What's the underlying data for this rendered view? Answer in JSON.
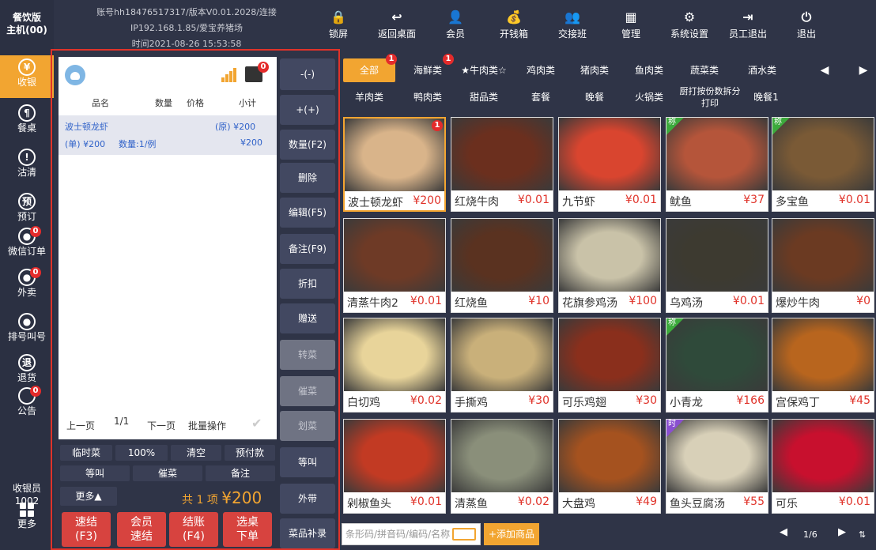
{
  "rail": {
    "brand_line1": "餐饮版",
    "brand_line2": "主机(00)",
    "items": [
      {
        "label": "收银",
        "icon": "¥",
        "badge": ""
      },
      {
        "label": "餐桌",
        "icon": "¶",
        "badge": ""
      },
      {
        "label": "沽清",
        "icon": "!",
        "badge": ""
      },
      {
        "label": "预订",
        "icon": "预",
        "badge": ""
      },
      {
        "label": "微信订单",
        "icon": "●",
        "badge": "0"
      },
      {
        "label": "外卖",
        "icon": "●",
        "badge": "0"
      },
      {
        "label": "排号叫号",
        "icon": "●",
        "badge": ""
      },
      {
        "label": "退货",
        "icon": "退",
        "badge": ""
      },
      {
        "label": "公告",
        "icon": "",
        "badge": "0"
      }
    ],
    "cashier_label": "收银员",
    "cashier_id": "1002",
    "more_label": "更多"
  },
  "info": {
    "account": "账号hh18476517317/版本V0.01.2028/连接",
    "ip": "IP192.168.1.85/爱宝养猪场",
    "time": "时间2021-08-26 15:53:58"
  },
  "toolbar": [
    {
      "label": "锁屏",
      "icon": "lock-icon",
      "glyph": "🔒"
    },
    {
      "label": "返回桌面",
      "icon": "back-icon",
      "glyph": "↩"
    },
    {
      "label": "会员",
      "icon": "member-icon",
      "glyph": "👤"
    },
    {
      "label": "开钱箱",
      "icon": "cash-box-icon",
      "glyph": "💰"
    },
    {
      "label": "交接班",
      "icon": "shift-icon",
      "glyph": "👥"
    },
    {
      "label": "管理",
      "icon": "grid-icon",
      "glyph": "▦"
    },
    {
      "label": "系统设置",
      "icon": "gear-icon",
      "glyph": "⚙"
    },
    {
      "label": "员工退出",
      "icon": "exit-door-icon",
      "glyph": "⇥"
    },
    {
      "label": "退出",
      "icon": "power-icon",
      "glyph": "⏻"
    }
  ],
  "order": {
    "printer_badge": "0",
    "columns": {
      "name": "品名",
      "qty": "数量",
      "price": "价格",
      "subtotal": "小计"
    },
    "line": {
      "name": "波士顿龙虾",
      "orig_price": "(原) ¥200",
      "unit_price": "(单) ¥200",
      "qty": "数量:1/例",
      "subtotal": "¥200"
    },
    "pager": {
      "prev": "上一页",
      "page": "1/1",
      "next": "下一页",
      "batch": "批量操作"
    },
    "row1": [
      "临时菜",
      "100%",
      "清空",
      "预付款"
    ],
    "row2": [
      "等叫",
      "催菜",
      "备注"
    ],
    "more": "更多▲",
    "total_prefix": "共",
    "total_count": "1",
    "total_unit": "项",
    "total_amount": "¥200",
    "buttons": [
      {
        "line1": "速结",
        "line2": "(F3)"
      },
      {
        "line1": "会员",
        "line2": "速结"
      },
      {
        "line1": "结账",
        "line2": "(F4)"
      },
      {
        "line1": "选桌",
        "line2": "下单"
      }
    ]
  },
  "actions": [
    {
      "label": "-(-)",
      "disabled": false
    },
    {
      "label": "+(+)",
      "disabled": false
    },
    {
      "label": "数量(F2)",
      "disabled": false
    },
    {
      "label": "删除",
      "disabled": false
    },
    {
      "label": "编辑(F5)",
      "disabled": false
    },
    {
      "label": "备注(F9)",
      "disabled": false
    },
    {
      "label": "折扣",
      "disabled": false
    },
    {
      "label": "赠送",
      "disabled": false
    },
    {
      "label": "转菜",
      "disabled": true
    },
    {
      "label": "催菜",
      "disabled": true
    },
    {
      "label": "划菜",
      "disabled": true
    },
    {
      "label": "等叫",
      "disabled": false
    },
    {
      "label": "外带",
      "disabled": false
    },
    {
      "label": "菜品补录",
      "disabled": false
    }
  ],
  "categories_row1": [
    {
      "label": "全部",
      "badge": "1",
      "active": true
    },
    {
      "label": "海鲜类",
      "badge": "1",
      "active": false
    },
    {
      "label": "★牛肉类☆",
      "badge": "",
      "active": false
    },
    {
      "label": "鸡肉类",
      "badge": "",
      "active": false
    },
    {
      "label": "猪肉类",
      "badge": "",
      "active": false
    },
    {
      "label": "鱼肉类",
      "badge": "",
      "active": false
    },
    {
      "label": "蔬菜类",
      "badge": "",
      "active": false
    },
    {
      "label": "酒水类",
      "badge": "",
      "active": false
    }
  ],
  "categories_row2": [
    {
      "label": "羊肉类"
    },
    {
      "label": "鸭肉类"
    },
    {
      "label": "甜品类"
    },
    {
      "label": "套餐"
    },
    {
      "label": "晚餐"
    },
    {
      "label": "火锅类"
    },
    {
      "label": "厨打按份数拆分打印"
    },
    {
      "label": "晚餐1"
    }
  ],
  "dishes": [
    {
      "name": "波士顿龙虾",
      "price": "¥200",
      "tag": "",
      "badge": "1",
      "color": "#d9b48a"
    },
    {
      "name": "红烧牛肉",
      "price": "¥0.01",
      "tag": "",
      "badge": "",
      "color": "#6b2f1e"
    },
    {
      "name": "九节虾",
      "price": "¥0.01",
      "tag": "",
      "badge": "",
      "color": "#d9452f"
    },
    {
      "name": "鱿鱼",
      "price": "¥37",
      "tag": "称",
      "badge": "",
      "color": "#b5553a"
    },
    {
      "name": "多宝鱼",
      "price": "¥0.01",
      "tag": "称",
      "badge": "",
      "color": "#7a5a36"
    },
    {
      "name": "清蒸牛肉2",
      "price": "¥0.01",
      "tag": "",
      "badge": "",
      "color": "#6e3a26"
    },
    {
      "name": "红烧鱼",
      "price": "¥10",
      "tag": "",
      "badge": "",
      "color": "#5a3220"
    },
    {
      "name": "花旗参鸡汤",
      "price": "¥100",
      "tag": "",
      "badge": "",
      "color": "#c9c2a8"
    },
    {
      "name": "乌鸡汤",
      "price": "¥0.01",
      "tag": "",
      "badge": "",
      "color": "#3d3a30"
    },
    {
      "name": "爆炒牛肉",
      "price": "¥0",
      "tag": "",
      "badge": "",
      "color": "#6b3a22"
    },
    {
      "name": "白切鸡",
      "price": "¥0.02",
      "tag": "",
      "badge": "",
      "color": "#e8d49a"
    },
    {
      "name": "手撕鸡",
      "price": "¥30",
      "tag": "",
      "badge": "",
      "color": "#c9b07a"
    },
    {
      "name": "可乐鸡翅",
      "price": "¥30",
      "tag": "",
      "badge": "",
      "color": "#8a2f1c"
    },
    {
      "name": "小青龙",
      "price": "¥166",
      "tag": "称",
      "badge": "",
      "color": "#2f4a3a"
    },
    {
      "name": "宫保鸡丁",
      "price": "¥45",
      "tag": "",
      "badge": "",
      "color": "#b8651e"
    },
    {
      "name": "剁椒鱼头",
      "price": "¥0.01",
      "tag": "",
      "badge": "",
      "color": "#c23a23"
    },
    {
      "name": "清蒸鱼",
      "price": "¥0.02",
      "tag": "",
      "badge": "",
      "color": "#8a8f7a"
    },
    {
      "name": "大盘鸡",
      "price": "¥49",
      "tag": "",
      "badge": "",
      "color": "#a5521f"
    },
    {
      "name": "鱼头豆腐汤",
      "price": "¥55",
      "tag": "时",
      "badge": "",
      "color": "#d8d0b8"
    },
    {
      "name": "可乐",
      "price": "¥0.01",
      "tag": "",
      "badge": "",
      "color": "#c8102e"
    }
  ],
  "bottom": {
    "search_placeholder": "条形码/拼音码/编码/名称",
    "add_label": "+添加商品",
    "page": "1/6"
  },
  "colors": {
    "accent": "#f2a531",
    "danger": "#e0332a",
    "bg": "#2f3447"
  }
}
